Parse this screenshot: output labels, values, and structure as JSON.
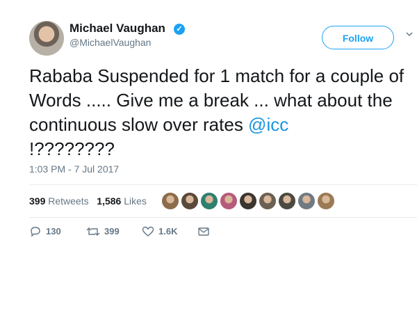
{
  "user": {
    "name": "Michael Vaughan",
    "handle": "@MichaelVaughan",
    "verified": true
  },
  "follow_label": "Follow",
  "tweet": {
    "text": "Rababa Suspended for 1 match for a couple of Words ..... Give me a break ... what about the continuous slow over rates ",
    "mention": "@icc",
    "text_end": "!????????"
  },
  "timestamp": "1:03 PM - 7 Jul 2017",
  "stats": {
    "retweets_count": "399",
    "retweets_label": "Retweets",
    "likes_count": "1,586",
    "likes_label": "Likes"
  },
  "liker_avatars": [
    {
      "name": "liker-avatar-1",
      "color": "#8c6d4a"
    },
    {
      "name": "liker-avatar-2",
      "color": "#5b4a3c"
    },
    {
      "name": "liker-avatar-3",
      "color": "#2f7f6f"
    },
    {
      "name": "liker-avatar-4",
      "color": "#b65a7c"
    },
    {
      "name": "liker-avatar-5",
      "color": "#3b3530"
    },
    {
      "name": "liker-avatar-6",
      "color": "#6b6053"
    },
    {
      "name": "liker-avatar-7",
      "color": "#4a4a42"
    },
    {
      "name": "liker-avatar-8",
      "color": "#707a80"
    },
    {
      "name": "liker-avatar-9",
      "color": "#9a7a55"
    }
  ],
  "actions": {
    "reply_count": "130",
    "retweet_count": "399",
    "like_count": "1.6K",
    "icons": [
      "reply-icon",
      "retweet-icon",
      "heart-icon",
      "message-icon"
    ]
  },
  "colors": {
    "accent": "#1da1f2",
    "link": "#1b95e0",
    "muted": "#657786",
    "divider": "#e6ecf0"
  }
}
